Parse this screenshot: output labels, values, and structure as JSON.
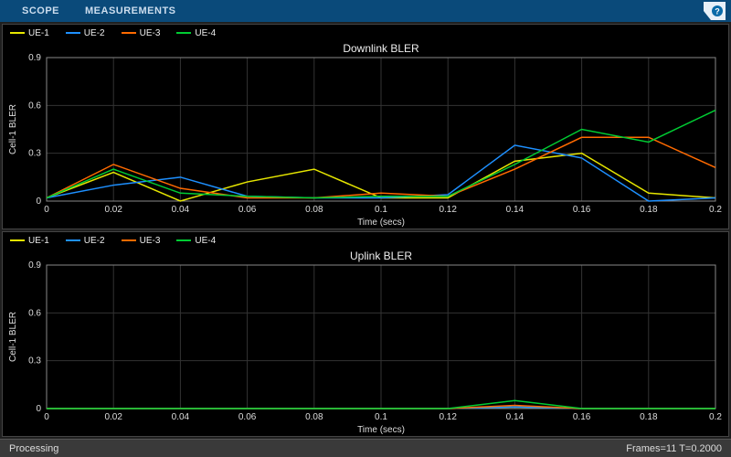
{
  "toolbar": {
    "tabs": [
      "SCOPE",
      "MEASUREMENTS"
    ],
    "help_icon": "help-icon"
  },
  "legend_items": [
    {
      "label": "UE-1",
      "color": "#e6e600"
    },
    {
      "label": "UE-2",
      "color": "#1e90ff"
    },
    {
      "label": "UE-3",
      "color": "#ff6a00"
    },
    {
      "label": "UE-4",
      "color": "#00cc33"
    }
  ],
  "status": {
    "left": "Processing",
    "right": "Frames=11  T=0.2000"
  },
  "chart_data": [
    {
      "type": "line",
      "title": "Downlink BLER",
      "xlabel": "Time (secs)",
      "ylabel": "Cell-1 BLER",
      "xlim": [
        0,
        0.2
      ],
      "ylim": [
        0,
        0.9
      ],
      "xticks": [
        0,
        0.02,
        0.04,
        0.06,
        0.08,
        0.1,
        0.12,
        0.14,
        0.16,
        0.18,
        0.2
      ],
      "yticks": [
        0,
        0.3,
        0.6,
        0.9
      ],
      "x": [
        0,
        0.02,
        0.04,
        0.06,
        0.08,
        0.1,
        0.12,
        0.14,
        0.16,
        0.18,
        0.2
      ],
      "series": [
        {
          "name": "UE-1",
          "color": "#e6e600",
          "values": [
            0.02,
            0.18,
            0.0,
            0.12,
            0.2,
            0.02,
            0.02,
            0.25,
            0.3,
            0.05,
            0.02
          ]
        },
        {
          "name": "UE-2",
          "color": "#1e90ff",
          "values": [
            0.02,
            0.1,
            0.15,
            0.03,
            0.02,
            0.02,
            0.04,
            0.35,
            0.27,
            0.0,
            0.02
          ]
        },
        {
          "name": "UE-3",
          "color": "#ff6a00",
          "values": [
            0.02,
            0.23,
            0.08,
            0.02,
            0.02,
            0.05,
            0.03,
            0.2,
            0.4,
            0.4,
            0.21
          ]
        },
        {
          "name": "UE-4",
          "color": "#00cc33",
          "values": [
            0.02,
            0.2,
            0.05,
            0.03,
            0.02,
            0.03,
            0.03,
            0.23,
            0.45,
            0.37,
            0.57
          ]
        }
      ]
    },
    {
      "type": "line",
      "title": "Uplink BLER",
      "xlabel": "Time (secs)",
      "ylabel": "Cell-1 BLER",
      "xlim": [
        0,
        0.2
      ],
      "ylim": [
        0,
        0.9
      ],
      "xticks": [
        0,
        0.02,
        0.04,
        0.06,
        0.08,
        0.1,
        0.12,
        0.14,
        0.16,
        0.18,
        0.2
      ],
      "yticks": [
        0,
        0.3,
        0.6,
        0.9
      ],
      "x": [
        0,
        0.02,
        0.04,
        0.06,
        0.08,
        0.1,
        0.12,
        0.14,
        0.16,
        0.18,
        0.2
      ],
      "series": [
        {
          "name": "UE-1",
          "color": "#e6e600",
          "values": [
            0,
            0,
            0,
            0,
            0,
            0,
            0,
            0.01,
            0.0,
            0,
            0
          ]
        },
        {
          "name": "UE-2",
          "color": "#1e90ff",
          "values": [
            0,
            0,
            0,
            0,
            0,
            0,
            0,
            0.01,
            0.0,
            0,
            0
          ]
        },
        {
          "name": "UE-3",
          "color": "#ff6a00",
          "values": [
            0,
            0,
            0,
            0,
            0,
            0,
            0,
            0.02,
            0.0,
            0,
            0
          ]
        },
        {
          "name": "UE-4",
          "color": "#00cc33",
          "values": [
            0,
            0,
            0,
            0,
            0,
            0,
            0,
            0.05,
            0.0,
            0,
            0
          ]
        }
      ]
    }
  ]
}
